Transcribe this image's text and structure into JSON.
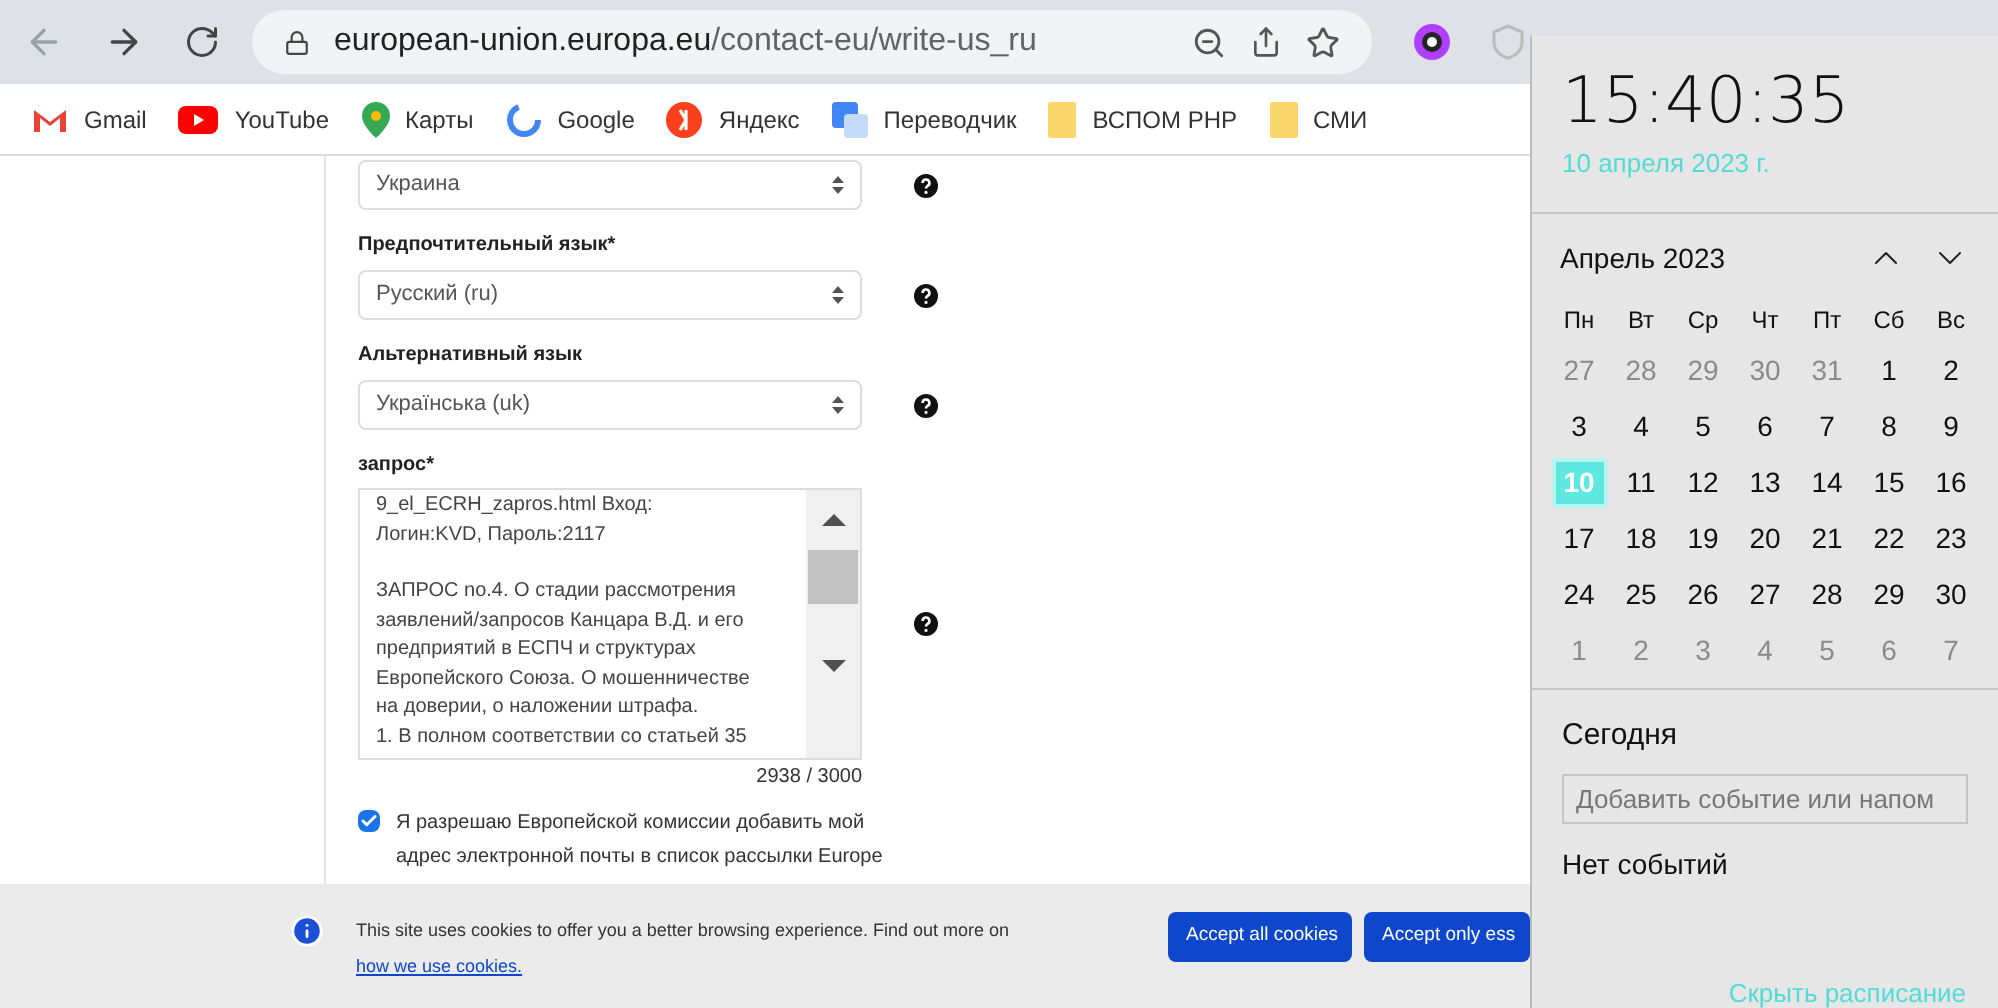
{
  "browser": {
    "url_host": "european-union.europa.eu",
    "url_path": "/contact-eu/write-us_ru"
  },
  "bookmarks": [
    {
      "label": "Gmail",
      "kind": "gmail"
    },
    {
      "label": "YouTube",
      "kind": "youtube"
    },
    {
      "label": "Карты",
      "kind": "maps"
    },
    {
      "label": "Google",
      "kind": "google"
    },
    {
      "label": "Яндекс",
      "kind": "yandex"
    },
    {
      "label": "Переводчик",
      "kind": "translate"
    },
    {
      "label": "ВСПОМ PHP",
      "kind": "folder"
    },
    {
      "label": "СМИ",
      "kind": "folder"
    }
  ],
  "form": {
    "fields": [
      {
        "kind": "select",
        "value": "Украина"
      },
      {
        "kind": "select",
        "label": "Предпочтительный язык*",
        "value": "Русский (ru)"
      },
      {
        "kind": "select",
        "label": "Альтернативный язык",
        "value": "Українська (uk)"
      }
    ],
    "request": {
      "label": "запрос*",
      "paragraphs": [
        [
          "9_el_ECRH_zapros.html  Вход:",
          "Логин:KVD, Пароль:2117"
        ],
        [
          "ЗАПРОС no.4. О стадии рассмотрения",
          "заявлений/запросов Канцара В.Д. и его",
          "предприятий в ЕСПЧ и структурах",
          "Европейского Союза. О мошенничестве",
          "на доверии, о наложении штрафа.",
          "1. В полном соответствии со статьей 35"
        ]
      ],
      "counter": "2938 / 3000"
    },
    "consent": {
      "checked": true,
      "text": "Я разрешаю Европейской комиссии добавить мой адрес электронной почты в список рассылки Europe"
    }
  },
  "cookie_banner": {
    "text": "This site uses cookies to offer you a better browsing experience. Find out more on",
    "link": "how we use cookies.",
    "buttons": [
      "Accept all cookies",
      "Accept only ess"
    ]
  },
  "clock": {
    "time": "15:40:35",
    "date": "10 апреля 2023 г.",
    "month": "Апрель 2023",
    "weekdays": [
      "Пн",
      "Вт",
      "Ср",
      "Чт",
      "Пт",
      "Сб",
      "Вс"
    ],
    "days": [
      {
        "d": "27",
        "muted": true,
        "selected": false
      },
      {
        "d": "28",
        "muted": true,
        "selected": false
      },
      {
        "d": "29",
        "muted": true,
        "selected": false
      },
      {
        "d": "30",
        "muted": true,
        "selected": false
      },
      {
        "d": "31",
        "muted": true,
        "selected": false
      },
      {
        "d": "1",
        "muted": false,
        "selected": false
      },
      {
        "d": "2",
        "muted": false,
        "selected": false
      },
      {
        "d": "3",
        "muted": false,
        "selected": false
      },
      {
        "d": "4",
        "muted": false,
        "selected": false
      },
      {
        "d": "5",
        "muted": false,
        "selected": false
      },
      {
        "d": "6",
        "muted": false,
        "selected": false
      },
      {
        "d": "7",
        "muted": false,
        "selected": false
      },
      {
        "d": "8",
        "muted": false,
        "selected": false
      },
      {
        "d": "9",
        "muted": false,
        "selected": false
      },
      {
        "d": "10",
        "muted": false,
        "selected": true
      },
      {
        "d": "11",
        "muted": false,
        "selected": false
      },
      {
        "d": "12",
        "muted": false,
        "selected": false
      },
      {
        "d": "13",
        "muted": false,
        "selected": false
      },
      {
        "d": "14",
        "muted": false,
        "selected": false
      },
      {
        "d": "15",
        "muted": false,
        "selected": false
      },
      {
        "d": "16",
        "muted": false,
        "selected": false
      },
      {
        "d": "17",
        "muted": false,
        "selected": false
      },
      {
        "d": "18",
        "muted": false,
        "selected": false
      },
      {
        "d": "19",
        "muted": false,
        "selected": false
      },
      {
        "d": "20",
        "muted": false,
        "selected": false
      },
      {
        "d": "21",
        "muted": false,
        "selected": false
      },
      {
        "d": "22",
        "muted": false,
        "selected": false
      },
      {
        "d": "23",
        "muted": false,
        "selected": false
      },
      {
        "d": "24",
        "muted": false,
        "selected": false
      },
      {
        "d": "25",
        "muted": false,
        "selected": false
      },
      {
        "d": "26",
        "muted": false,
        "selected": false
      },
      {
        "d": "27",
        "muted": false,
        "selected": false
      },
      {
        "d": "28",
        "muted": false,
        "selected": false
      },
      {
        "d": "29",
        "muted": false,
        "selected": false
      },
      {
        "d": "30",
        "muted": false,
        "selected": false
      },
      {
        "d": "1",
        "muted": true,
        "selected": false
      },
      {
        "d": "2",
        "muted": true,
        "selected": false
      },
      {
        "d": "3",
        "muted": true,
        "selected": false
      },
      {
        "d": "4",
        "muted": true,
        "selected": false
      },
      {
        "d": "5",
        "muted": true,
        "selected": false
      },
      {
        "d": "6",
        "muted": true,
        "selected": false
      },
      {
        "d": "7",
        "muted": true,
        "selected": false
      }
    ],
    "today": "Сегодня",
    "event_placeholder": "Добавить событие или напом",
    "no_events": "Нет событий",
    "hide_schedule": "Скрыть расписание"
  }
}
